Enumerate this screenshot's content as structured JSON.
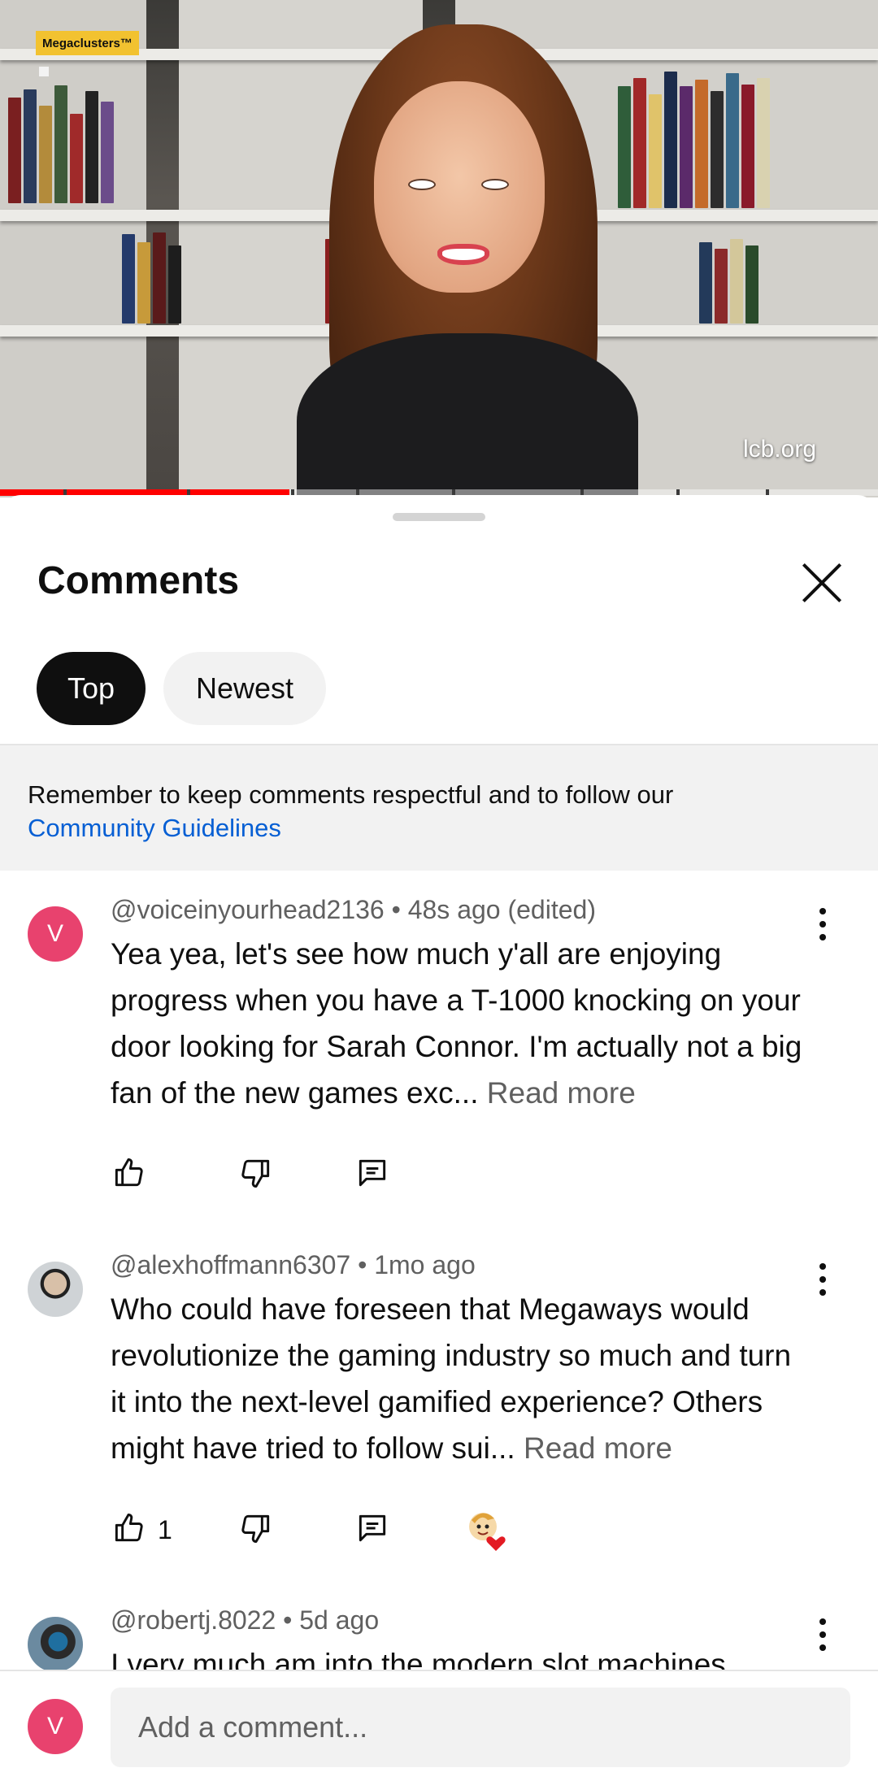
{
  "video": {
    "badge": "Megaclusters™",
    "watermark": "lcb.org",
    "progress": 0.33
  },
  "sheet": {
    "title": "Comments",
    "close_icon": "close-icon",
    "filters": [
      {
        "label": "Top",
        "selected": true
      },
      {
        "label": "Newest",
        "selected": false
      }
    ],
    "notice": {
      "text": "Remember to keep comments respectful and to follow our",
      "link": "Community Guidelines"
    }
  },
  "comments": [
    {
      "avatar_letter": "V",
      "author": "@voiceinyourhead2136",
      "time": "48s ago (edited)",
      "meta": "@voiceinyourhead2136 • 48s ago (edited)",
      "text": "Yea yea, let's see how much y'all are enjoying progress when you have a T-1000 knocking on your door looking for Sarah Connor. I'm actually not a big fan of the new games exc... ",
      "read_more": "Read more",
      "likes": ""
    },
    {
      "avatar_letter": "",
      "author": "@alexhoffmann6307",
      "time": "1mo ago",
      "meta": "@alexhoffmann6307 • 1mo ago",
      "text": "Who could have foreseen that Megaways would revolutionize the gaming industry so much and turn it into the next-level gamified experience? Others might have tried to follow sui... ",
      "read_more": "Read more",
      "likes": "1",
      "creator_heart": true
    },
    {
      "avatar_letter": "",
      "author": "@robertj.8022",
      "time": "5d ago",
      "meta": "@robertj.8022 • 5d ago",
      "text": "I very much am into the modern slot machines",
      "read_more": "",
      "likes": ""
    }
  ],
  "composer": {
    "avatar_letter": "V",
    "placeholder": "Add a comment..."
  },
  "colors": {
    "accent_link": "#065fd4",
    "avatar_v": "#e8426e",
    "progress_red": "#ff0000"
  }
}
